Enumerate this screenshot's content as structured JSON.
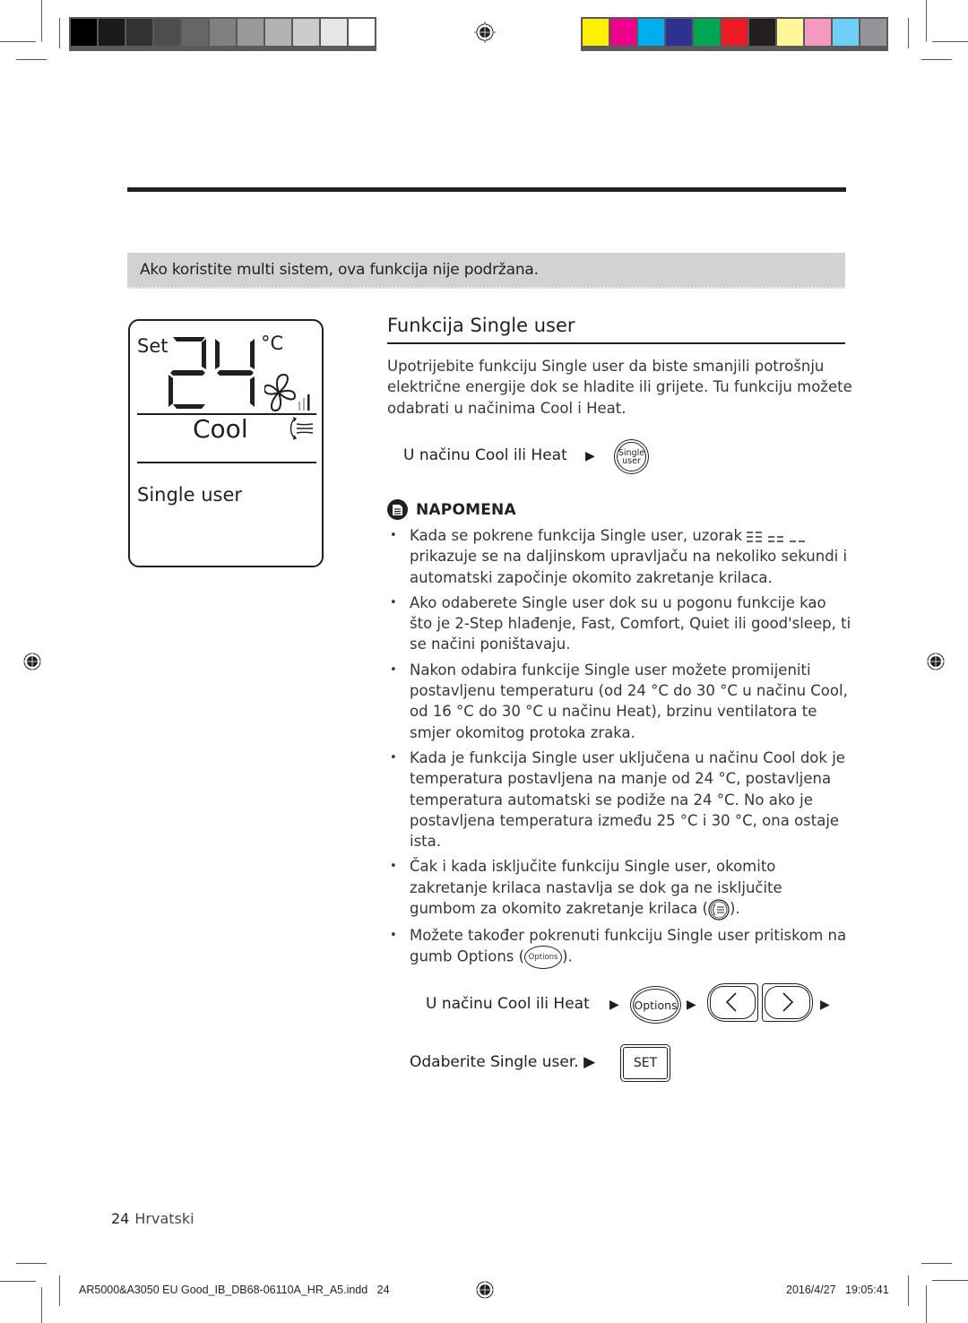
{
  "print_marks": {
    "grayscale_swatches": [
      "#000000",
      "#1a1a1a",
      "#333333",
      "#4d4d4d",
      "#666666",
      "#808080",
      "#999999",
      "#b3b3b3",
      "#cccccc",
      "#e6e6e6",
      "#ffffff"
    ],
    "color_swatches": [
      "#fff200",
      "#ec008c",
      "#00aeef",
      "#2e3192",
      "#00a651",
      "#ed1c24",
      "#231f20",
      "#fff799",
      "#f49ac1",
      "#6dcff6",
      "#939598"
    ]
  },
  "notice": {
    "text": "Ako koristite multi sistem, ova funkcija nije podržana.",
    "background": "#d1d2d4"
  },
  "lcd": {
    "set_label": "Set",
    "temperature": "24",
    "unit": "°C",
    "mode": "Cool",
    "function": "Single user",
    "fan_icon": "fan-icon",
    "swing_icon": "vertical-swing-icon"
  },
  "section": {
    "title": "Funkcija Single user",
    "intro": "Upotrijebite funkciju Single user da biste smanjili potrošnju električne energije dok se hladite ili grijete. Tu funkciju možete odabrati u načinima Cool i Heat.",
    "step1": {
      "text": "U načinu Cool ili Heat",
      "arrow": "▶",
      "button_line1": "Single",
      "button_line2": "user"
    }
  },
  "note": {
    "heading": "NAPOMENA",
    "icon": "note-icon",
    "items": [
      {
        "before": "Kada se pokrene funkcija Single user, uzorak ",
        "after": " prikazuje se na daljinskom upravljaču na nekoliko sekundi i automatski započinje okomito zakretanje krilaca."
      },
      {
        "text": "Ako odaberete Single user dok su u pogonu funkcije kao što je 2-Step hlađenje, Fast, Comfort, Quiet ili good'sleep, ti se načini poništavaju."
      },
      {
        "text": "Nakon odabira funkcije Single user možete promijeniti postavljenu temperaturu (od 24 °C do 30 °C u načinu Cool, od 16 °C do 30 °C u načinu Heat), brzinu ventilatora te smjer okomitog protoka zraka."
      },
      {
        "text": "Kada je funkcija Single user uključena u načinu Cool dok je temperatura postavljena na manje od 24 °C, postavljena temperatura automatski se podiže na 24 °C. No ako je postavljena temperatura između 25 °C i 30 °C, ona ostaje ista."
      },
      {
        "before": "Čak i kada isključite funkciju Single user, okomito zakretanje krilaca nastavlja se dok ga ne isključite gumbom za okomito zakretanje krilaca (",
        "after": ")."
      },
      {
        "before": "Možete također pokrenuti funkciju Single user pritiskom na gumb Options (",
        "button": "Options",
        "after": ")."
      }
    ]
  },
  "step2": {
    "text": "U načinu Cool ili Heat",
    "arrow": "▶",
    "options_label": "Options",
    "left_label": "<",
    "right_label": ">"
  },
  "step3": {
    "text": "Odaberite Single user. ▶",
    "set_label": "SET"
  },
  "footer": {
    "page_number": "24",
    "language": "Hrvatski",
    "file_slug": "AR5000&A3050 EU Good_IB_DB68-06110A_HR_A5.indd   24",
    "timestamp": "2016/4/27   19:05:41"
  }
}
